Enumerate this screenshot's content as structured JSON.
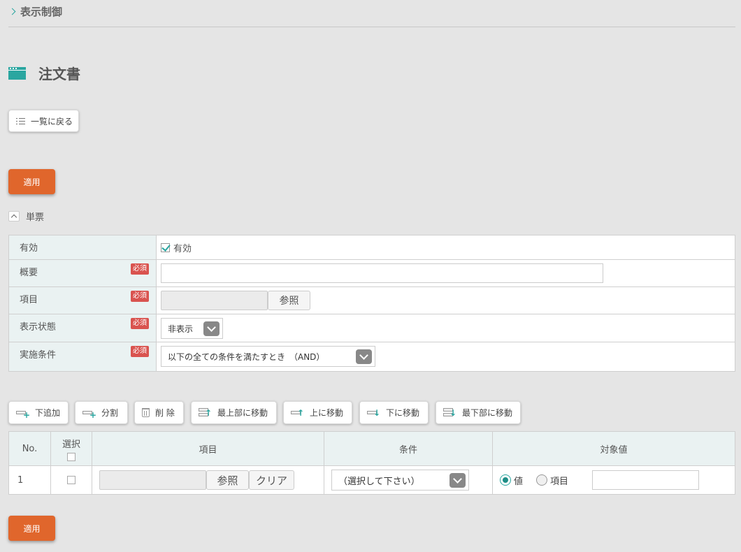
{
  "breadcrumb": {
    "label": "表示制御"
  },
  "page": {
    "title": "注文書"
  },
  "buttons": {
    "back": "一覧に戻る",
    "apply": "適用"
  },
  "section": {
    "title": "単票"
  },
  "form": {
    "required_label": "必須",
    "fields": {
      "enabled": {
        "label": "有効",
        "checkbox_label": "有効",
        "checked": true
      },
      "summary": {
        "label": "概要",
        "value": ""
      },
      "item": {
        "label": "項目",
        "ref_button": "参照"
      },
      "display_state": {
        "label": "表示状態",
        "selected": "非表示"
      },
      "condition": {
        "label": "実施条件",
        "selected": "以下の全ての条件を満たすとき　（AND）"
      }
    }
  },
  "toolbar": {
    "add_below": "下追加",
    "split": "分割",
    "delete": "削 除",
    "move_top": "最上部に移動",
    "move_up": "上に移動",
    "move_down": "下に移動",
    "move_bottom": "最下部に移動"
  },
  "cond_table": {
    "headers": {
      "no": "No.",
      "select": "選択",
      "item": "項目",
      "condition": "条件",
      "target": "対象値"
    },
    "rows": [
      {
        "no": "1",
        "ref_button": "参照",
        "clear_button": "クリア",
        "condition_selected": "（選択して下さい）",
        "radio_value": "値",
        "radio_item": "項目",
        "target_value": ""
      }
    ]
  },
  "colors": {
    "accent": "#2aa6a0",
    "apply": "#e0662c",
    "required": "#d9534f"
  }
}
